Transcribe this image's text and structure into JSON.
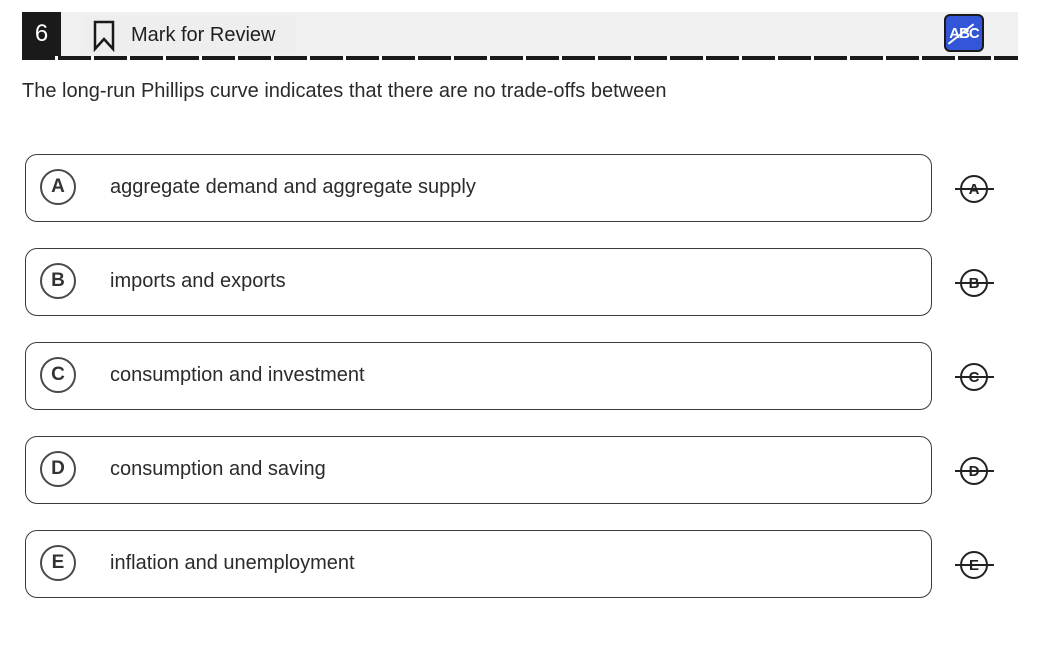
{
  "header": {
    "question_number": "6",
    "mark_for_review_label": "Mark for Review",
    "bookmark_icon": "bookmark-outline-icon",
    "abc_icon": "abc-strikethrough-icon",
    "abc_label": "ABC",
    "accent_color": "#3355d8"
  },
  "question": {
    "text": "The long-run Phillips curve indicates that there are no trade-offs between"
  },
  "choices": [
    {
      "letter": "A",
      "text": "aggregate demand and aggregate supply",
      "strike_letter": "A"
    },
    {
      "letter": "B",
      "text": "imports and exports",
      "strike_letter": "B"
    },
    {
      "letter": "C",
      "text": "consumption and investment",
      "strike_letter": "C"
    },
    {
      "letter": "D",
      "text": "consumption and saving",
      "strike_letter": "D"
    },
    {
      "letter": "E",
      "text": "inflation and unemployment",
      "strike_letter": "E"
    }
  ]
}
